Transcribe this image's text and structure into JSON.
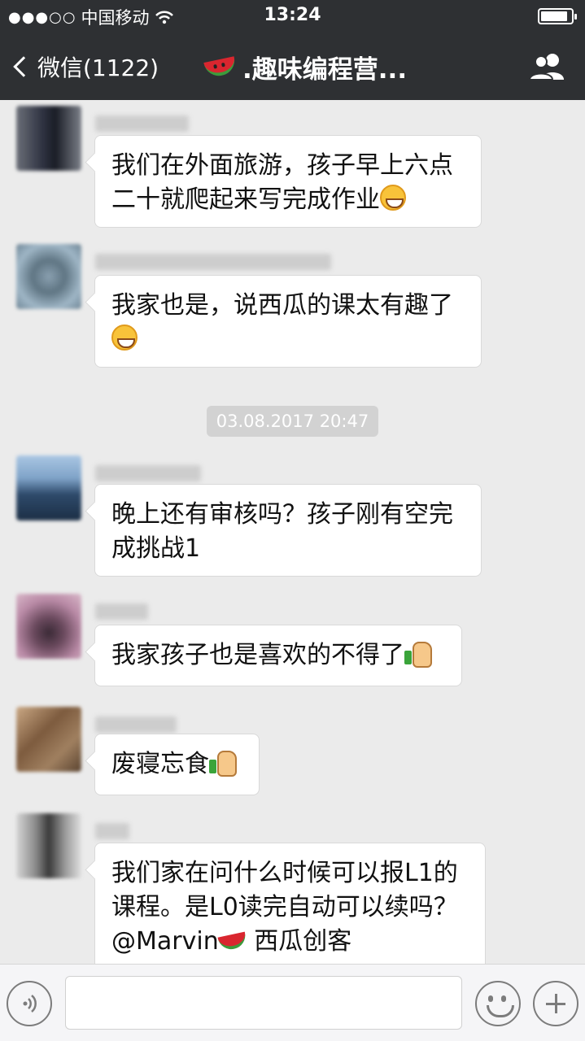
{
  "status_bar": {
    "signal": "●●●○○",
    "carrier": "中国移动",
    "time": "13:24"
  },
  "nav": {
    "back_label": "微信(1122)",
    "title": ".趣味编程营..."
  },
  "messages": [
    {
      "text": "我们在外面旅游，孩子早上六点二十就爬起来写完成作业",
      "emoji": "grinning-emoji"
    },
    {
      "text": "我家也是，说西瓜的课太有趣了",
      "emoji": "grinning-emoji"
    },
    {
      "text": "晚上还有审核吗？孩子刚有空完成挑战1"
    },
    {
      "text": "我家孩子也是喜欢的不得了",
      "emoji": "thumbs-up-emoji"
    },
    {
      "text": "废寝忘食",
      "emoji": "thumbs-up-emoji"
    },
    {
      "text_part1": "我们家在问什么时候可以报L1的课程。是L0读完自动可以续吗？@Marvin",
      "emoji": "watermelon-emoji",
      "text_part2": " 西瓜创客"
    }
  ],
  "timestamp": "03.08.2017 20:47",
  "icons": {
    "back": "chevron-left-icon",
    "group": "group-members-icon",
    "voice": "voice-icon",
    "emoji": "emoji-face-icon",
    "more": "plus-icon"
  },
  "colors": {
    "header_bg": "#2e3033",
    "chat_bg": "#ebebeb",
    "bubble_bg": "#ffffff",
    "timestamp_bg": "#d2d2d2"
  }
}
